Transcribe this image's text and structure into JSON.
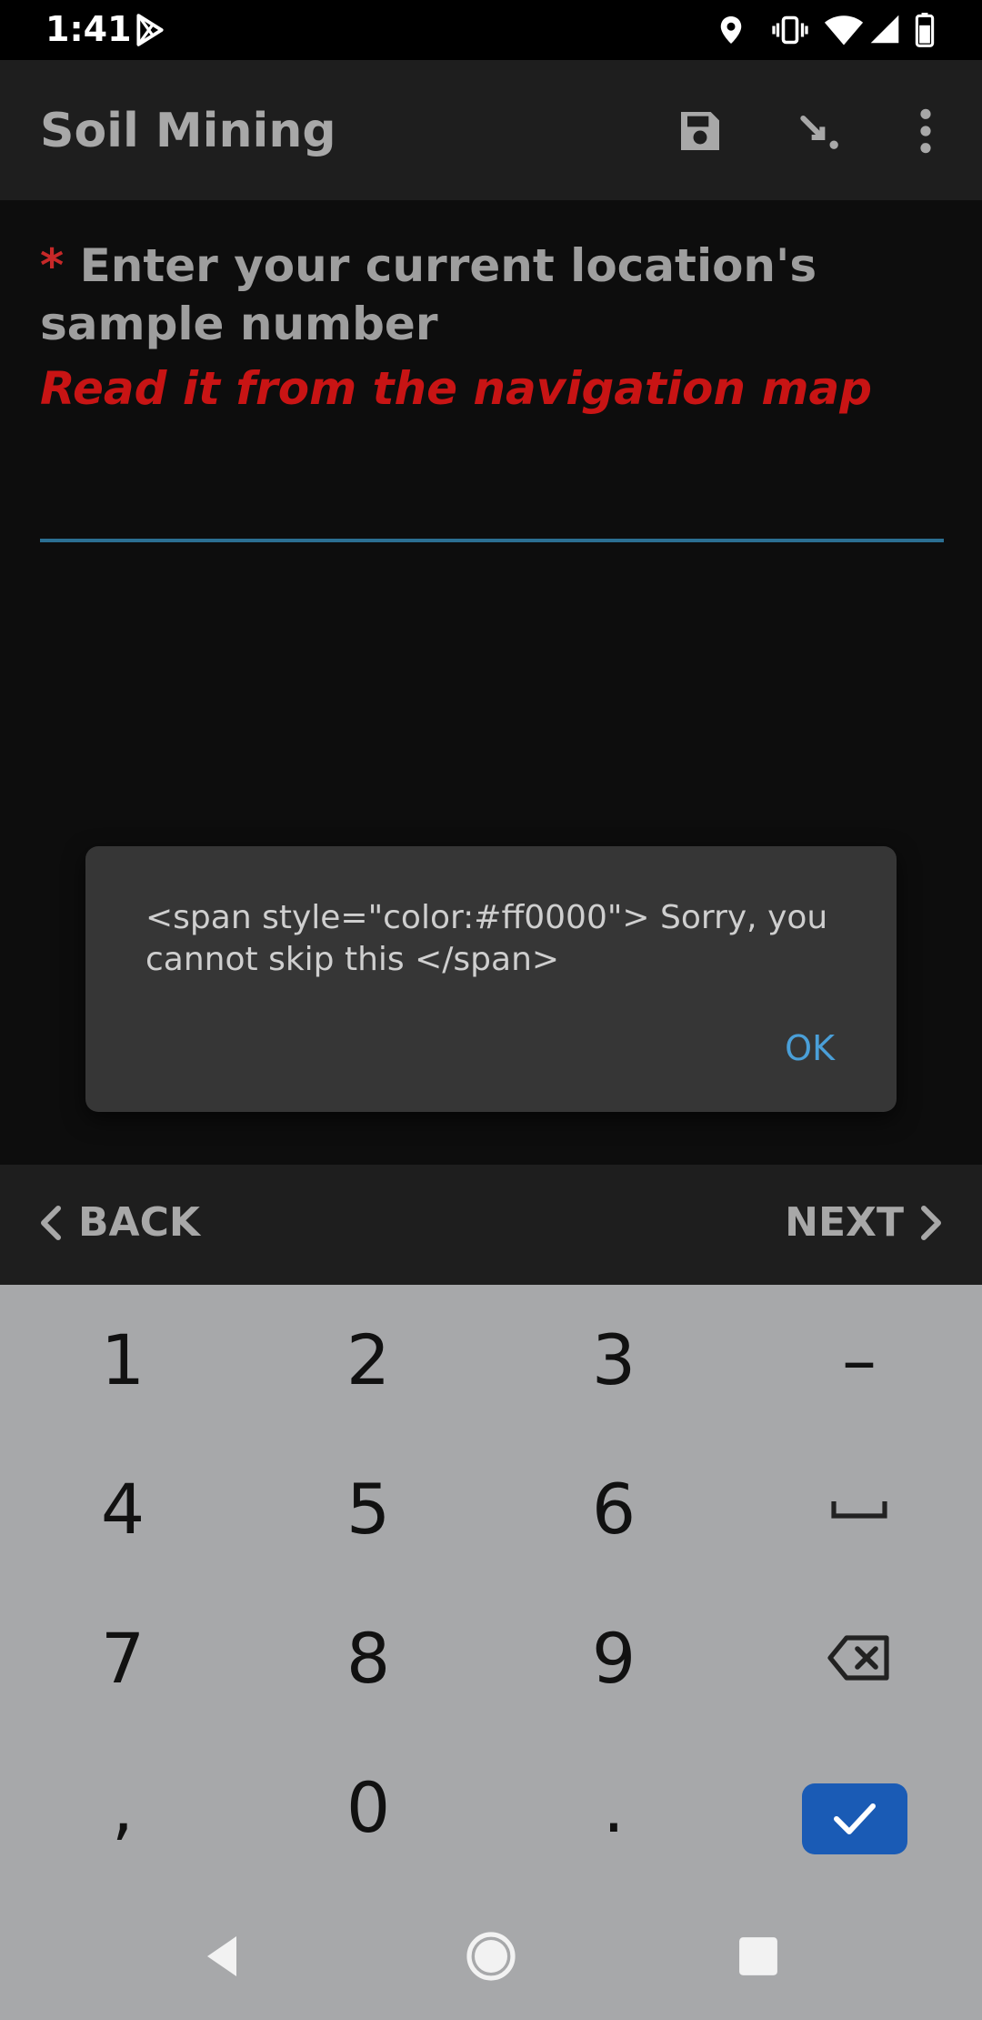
{
  "status_bar": {
    "time": "1:41",
    "icons": [
      "play-store-icon",
      "location-icon",
      "vibrate-icon",
      "wifi-icon",
      "cell-signal-icon",
      "battery-icon"
    ]
  },
  "toolbar": {
    "title": "Soil Mining",
    "actions": [
      "save-icon",
      "jump-icon",
      "overflow-menu-icon"
    ]
  },
  "question": {
    "required_marker": "*",
    "label": "Enter your current location's sample number",
    "hint": "Read it from the navigation map",
    "value": ""
  },
  "dialog": {
    "message": "<span style=\"color:#ff0000\"> Sorry, you cannot skip this </span>",
    "ok_label": "OK"
  },
  "navigation": {
    "back_label": "BACK",
    "next_label": "NEXT"
  },
  "keyboard": {
    "keys": [
      "1",
      "2",
      "3",
      "–",
      "4",
      "5",
      "6",
      "",
      "7",
      "8",
      "9",
      "",
      ",",
      "0",
      "."
    ],
    "special_icons": [
      "space-key-icon",
      "backspace-icon",
      "enter-check-icon"
    ]
  },
  "colors": {
    "accent": "#2b6f92",
    "required": "#c62828",
    "hint": "#c81414",
    "dialog_button": "#4a9fd8",
    "enter_key": "#1a5bb5"
  }
}
